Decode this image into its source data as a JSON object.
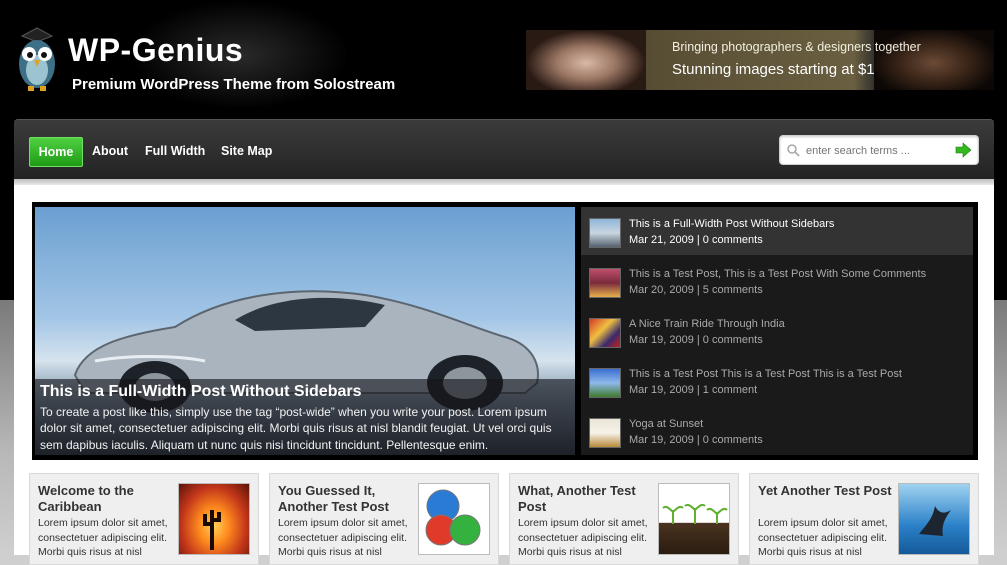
{
  "header": {
    "site_title": "WP-Genius",
    "tagline": "Premium WordPress Theme from Solostream",
    "logo_icon": "owl-icon",
    "banner": {
      "line1": "Bringing photographers & designers together",
      "line2": "Stunning images starting at $1"
    }
  },
  "nav": {
    "items": [
      {
        "label": "Home",
        "active": true
      },
      {
        "label": "About"
      },
      {
        "label": "Full Width"
      },
      {
        "label": "Site Map"
      }
    ],
    "search": {
      "placeholder": "enter search terms ..."
    }
  },
  "featured": {
    "title": "This is a Full-Width Post Without Sidebars",
    "excerpt": "To create a post like this, simply use the tag “post-wide” when you write your post. Lorem ipsum dolor sit amet, consectetuer adipiscing elit. Morbi quis risus at nisl blandit feugiat. Ut vel orci quis sem dapibus iaculis. Aliquam ut nunc quis nisi tincidunt tincidunt. Pellentesque enim.",
    "list": [
      {
        "title": "This is a Full-Width Post Without Sidebars",
        "meta": "Mar 21, 2009 | 0 comments",
        "active": true
      },
      {
        "title": "This is a Test Post, This is a Test Post With Some Comments",
        "meta": "Mar 20, 2009 | 5 comments"
      },
      {
        "title": "A Nice Train Ride Through India",
        "meta": "Mar 19, 2009 | 0 comments"
      },
      {
        "title": "This is a Test Post This is a Test Post This is a Test Post",
        "meta": "Mar 19, 2009 | 1 comment"
      },
      {
        "title": "Yoga at Sunset",
        "meta": "Mar 19, 2009 | 0 comments"
      }
    ]
  },
  "posts": [
    {
      "title": "Welcome to the Caribbean",
      "text": "Lorem ipsum dolor sit amet, consectetuer adipiscing elit. Morbi quis risus at nisl"
    },
    {
      "title": "You Guessed It, Another Test Post",
      "text": "Lorem ipsum dolor sit amet, consectetuer adipiscing elit. Morbi quis risus at nisl"
    },
    {
      "title": "What, Another Test Post",
      "text": "Lorem ipsum dolor sit amet, consectetuer adipiscing elit. Morbi quis risus at nisl"
    },
    {
      "title": "Yet Another Test Post",
      "text": "Lorem ipsum dolor sit amet, consectetuer adipiscing elit. Morbi quis risus at nisl"
    }
  ]
}
